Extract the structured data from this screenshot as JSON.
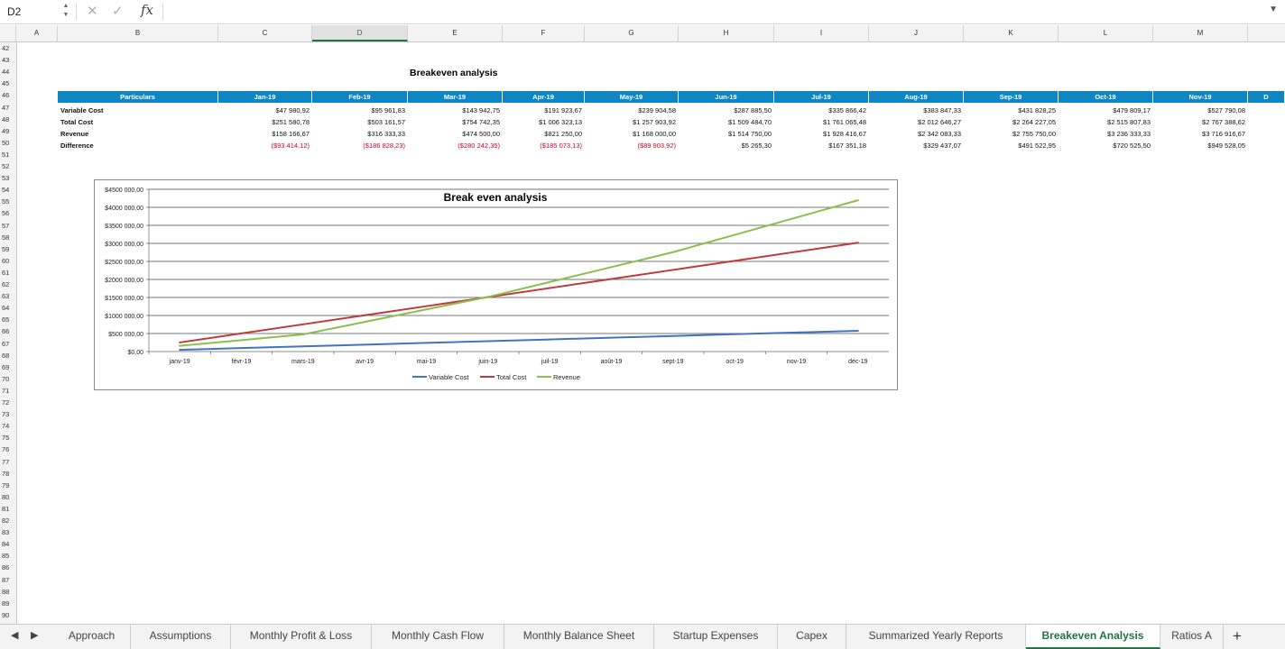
{
  "formula_bar": {
    "cell_ref": "D2",
    "formula": ""
  },
  "columns": [
    "A",
    "B",
    "C",
    "D",
    "E",
    "F",
    "G",
    "H",
    "I",
    "J",
    "K",
    "L",
    "M"
  ],
  "selected_column": "D",
  "rows": [
    "42",
    "43",
    "44",
    "45",
    "46",
    "47",
    "48",
    "49",
    "50",
    "51",
    "52",
    "53",
    "54",
    "55",
    "56",
    "57",
    "58",
    "59",
    "60",
    "61",
    "62",
    "63",
    "64",
    "65",
    "66",
    "67",
    "68",
    "69",
    "70",
    "71",
    "72",
    "73",
    "74",
    "75",
    "76",
    "77",
    "78",
    "79",
    "80",
    "81",
    "82",
    "83",
    "84",
    "85",
    "86",
    "87",
    "88",
    "89",
    "90"
  ],
  "table": {
    "title": "Breakeven analysis",
    "headers": [
      "Particulars",
      "Jan-19",
      "Feb-19",
      "Mar-19",
      "Apr-19",
      "May-19",
      "Jun-19",
      "Jul-19",
      "Aug-19",
      "Sep-19",
      "Oct-19",
      "Nov-19",
      "D"
    ],
    "rows": [
      {
        "label": "Variable Cost",
        "values": [
          "$47 980,92",
          "$95 961,83",
          "$143 942,75",
          "$191 923,67",
          "$239 904,58",
          "$287 885,50",
          "$335 866,42",
          "$383 847,33",
          "$431 828,25",
          "$479 809,17",
          "$527 790,08"
        ]
      },
      {
        "label": "Total Cost",
        "values": [
          "$251 580,78",
          "$503 161,57",
          "$754 742,35",
          "$1 006 323,13",
          "$1 257 903,92",
          "$1 509 484,70",
          "$1 761 065,48",
          "$2 012 646,27",
          "$2 264 227,05",
          "$2 515 807,83",
          "$2 767 388,62"
        ]
      },
      {
        "label": "Revenue",
        "values": [
          "$158 166,67",
          "$316 333,33",
          "$474 500,00",
          "$821 250,00",
          "$1 168 000,00",
          "$1 514 750,00",
          "$1 928 416,67",
          "$2 342 083,33",
          "$2 755 750,00",
          "$3 236 333,33",
          "$3 716 916,67"
        ]
      },
      {
        "label": "Difference",
        "values": [
          "($93 414,12)",
          "($186 828,23)",
          "($280 242,35)",
          "($185 073,13)",
          "($89 903,92)",
          "$5 265,30",
          "$167 351,18",
          "$329 437,07",
          "$491 522,95",
          "$720 525,50",
          "$949 528,05"
        ],
        "negative_count": 5
      }
    ]
  },
  "chart_data": {
    "type": "line",
    "title": "Break even analysis",
    "categories": [
      "janv-19",
      "févr-19",
      "mars-19",
      "avr-19",
      "mai-19",
      "juin-19",
      "juil-19",
      "août-19",
      "sept-19",
      "oct-19",
      "nov-19",
      "déc-19"
    ],
    "ylim": [
      0,
      4500000
    ],
    "yticks": [
      "$0,00",
      "$500 000,00",
      "$1000 000,00",
      "$1500 000,00",
      "$2000 000,00",
      "$2500 000,00",
      "$3000 000,00",
      "$3500 000,00",
      "$4000 000,00",
      "$4500 000,00"
    ],
    "grid": true,
    "legend_position": "bottom",
    "series": [
      {
        "name": "Variable Cost",
        "color": "#4472c4",
        "values": [
          47981,
          95962,
          143943,
          191924,
          239905,
          287886,
          335866,
          383847,
          431828,
          479809,
          527790,
          575771
        ]
      },
      {
        "name": "Total Cost",
        "color": "#c0393b",
        "values": [
          251581,
          503162,
          754742,
          1006323,
          1257904,
          1509485,
          1761065,
          2012646,
          2264227,
          2515808,
          2767389,
          3018969
        ]
      },
      {
        "name": "Revenue",
        "color": "#8bbf4e",
        "values": [
          158167,
          316333,
          474500,
          821250,
          1168000,
          1514750,
          1928417,
          2342083,
          2755750,
          3236333,
          3716917,
          4197500
        ]
      }
    ]
  },
  "tabs": [
    {
      "label": "Approach",
      "active": false
    },
    {
      "label": "Assumptions",
      "active": false
    },
    {
      "label": "Monthly Profit & Loss",
      "active": false
    },
    {
      "label": "Monthly Cash Flow",
      "active": false
    },
    {
      "label": "Monthly Balance Sheet",
      "active": false
    },
    {
      "label": "Startup Expenses",
      "active": false
    },
    {
      "label": "Capex",
      "active": false
    },
    {
      "label": "Summarized Yearly Reports",
      "active": false
    },
    {
      "label": "Breakeven Analysis",
      "active": true
    },
    {
      "label": "Ratios A",
      "active": false
    }
  ],
  "icons": {
    "cancel": "close-icon",
    "confirm": "check-icon",
    "function": "fx-icon",
    "add_sheet": "plus-icon"
  }
}
